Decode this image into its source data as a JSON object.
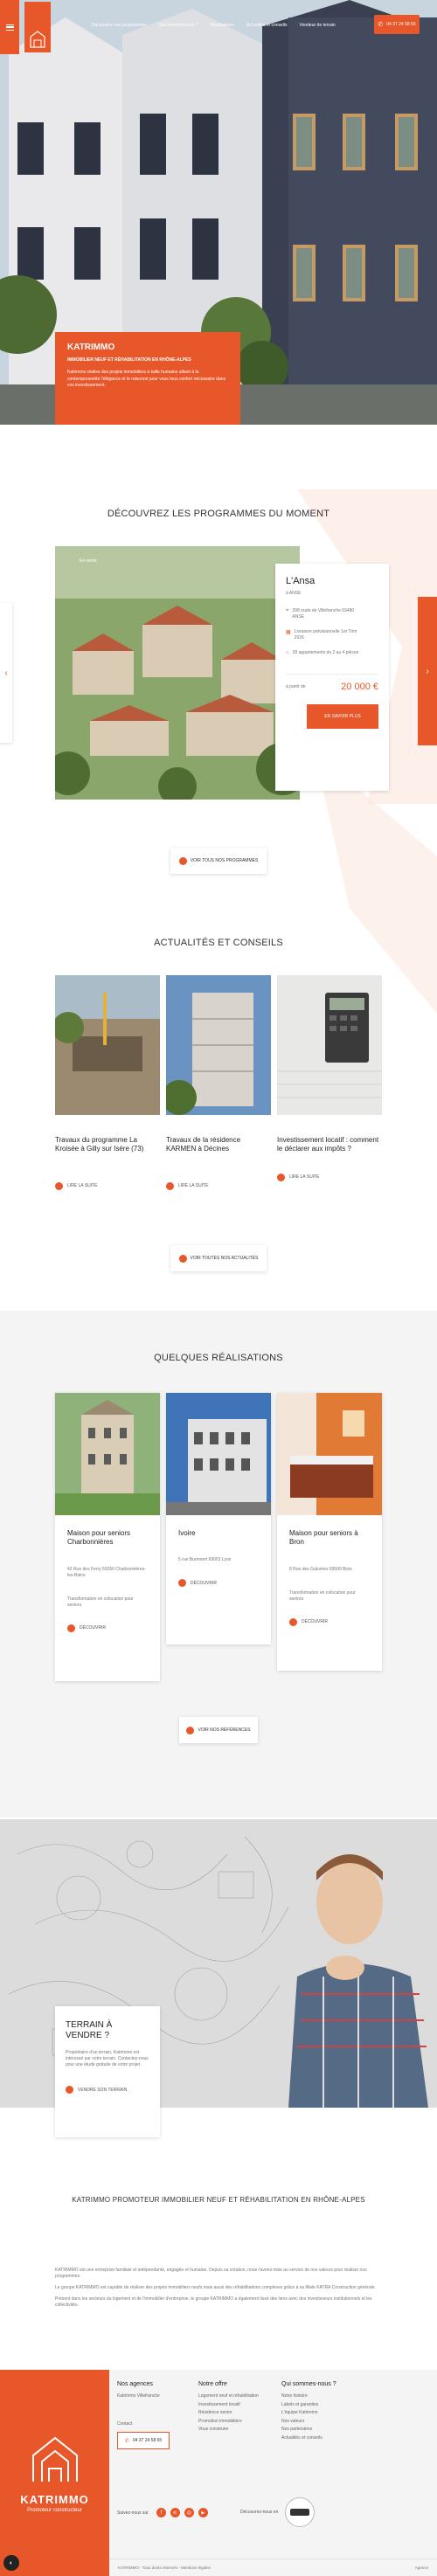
{
  "header": {
    "nav": [
      "Découvrez nos programmes",
      "Qui sommes-nous ?",
      "Réalisations",
      "Actualités et conseils",
      "Vendeur de terrain"
    ],
    "phone": "04 37 24 58 65"
  },
  "hero": {
    "brand": "KATRIMMO",
    "subtitle": "IMMOBILIER NEUF ET RÉHABILITATION EN RHÔNE-ALPES",
    "text": "Katrimmo réalise des projets immobiliers à taille humaine alliant à la contemporanéité l'élégance et le raisonné pour vous tous confort nécessaire dans vos investissement."
  },
  "programs": {
    "title": "DÉCOUVREZ LES PROGRAMMES DU MOMENT",
    "badge": "En vente",
    "name": "L'Ansa",
    "city": "à ANSE",
    "address": "398 route de Villefranche 69480 ANSE",
    "delivery": "Livraison prévisionnelle 1er Trim 2026",
    "lots": "28 appartements du 2 au 4 pièces",
    "price_label": "à partir de",
    "price": "20 000 €",
    "more_button": "EN SAVOIR PLUS",
    "all_button": "VOIR TOUS NOS PROGRAMMES"
  },
  "news": {
    "title": "ACTUALITÉS ET CONSEILS",
    "items": [
      {
        "title": "Travaux du programme La Kroisée à Gilly sur Isère (73)",
        "link": "LIRE LA SUITE"
      },
      {
        "title": "Travaux de la résidence KARMEN à Décines",
        "link": "LIRE LA SUITE"
      },
      {
        "title": "Investissement locatif : comment le déclarer aux impôts ?",
        "link": "LIRE LA SUITE"
      }
    ],
    "all_button": "VOIR TOUTES NOS ACTUALITÉS"
  },
  "realisations": {
    "title": "QUELQUES RÉALISATIONS",
    "items": [
      {
        "title": "Maison pour seniors Charbonnières",
        "address": "42 Rue des Ferry 69260 Charbonnières-les-Bains",
        "desc": "Transformation en colocation pour seniors",
        "link": "DÉCOUVRIR"
      },
      {
        "title": "Ivoire",
        "address": "5 rue Burmond 69003 Lyon",
        "desc": "",
        "link": "DÉCOUVRIR"
      },
      {
        "title": "Maison pour seniors à Bron",
        "address": "8 Rue des Galurnes 69500 Bron",
        "desc": "Transformation en colocation pour seniors",
        "link": "DÉCOUVRIR"
      }
    ],
    "all_button": "VOIR NOS RÉFÉRENCES"
  },
  "terrain": {
    "title": "TERRAIN À VENDRE ?",
    "text": "Propriétaire d'un terrain, Katrimmo est intéressé par votre terrain. Contactez-nous pour une étude gratuite de votre projet.",
    "button": "VENDRE SON TERRAIN"
  },
  "about": {
    "title": "KATRIMMO PROMOTEUR IMMOBILIER NEUF ET RÉHABILITATION EN RHÔNE-ALPES",
    "p1": "KATRIMMO est une entreprise familiale et indépendante, engagée et humaine. Depuis sa création, nous l'avons mise au service de nos valeurs pour réaliser nos programmes.",
    "p2": "Le groupe KATRIMMO est capable de réaliser des projets immobiliers neufs mais aussi des réhabilitations complexes grâce à sa filiale KATRA Construction générale.",
    "p3": "Présent dans les secteurs du logement et de l'immobilier d'entreprise, le groupe KATRIMMO a également tissé des liens avec des investisseurs institutionnels et les collectivités."
  },
  "footer": {
    "logo_text": "KATRIMMO",
    "logo_sub": "Promoteur constructeur",
    "col1_title": "Nos agences",
    "col1_items": [
      "Katrimmo Villefranche"
    ],
    "contact_label": "Contact",
    "phone": "04 37 24 58 65",
    "col2_title": "Notre offre",
    "col2_items": [
      "Logement neuf et réhabilitation",
      "Investissement locatif",
      "Résidence senior",
      "Promotion immobilière",
      "Vous construire"
    ],
    "col3_title": "Qui sommes-nous ?",
    "col3_items": [
      "Notre histoire",
      "Labels et garanties",
      "L'équipe Katrimmo",
      "Nos valeurs",
      "Nos partenaires",
      "Actualités et conseils"
    ],
    "follow": "Suivez-nous sur",
    "discover": "Découvrez-nous en",
    "copyright": "KATRIMMO - Tous droits réservés - Mentions légales",
    "credit": "Agence"
  },
  "colors": {
    "accent": "#e8572a",
    "dark": "#333333",
    "light_bg": "#f4f4f4"
  },
  "icons": [
    "menu-icon",
    "phone-icon",
    "chevron-left-icon",
    "chevron-right-icon",
    "location-icon",
    "calendar-icon",
    "home-icon",
    "arrow-right-icon",
    "facebook-icon",
    "linkedin-icon",
    "instagram-icon",
    "youtube-icon",
    "cookie-icon"
  ]
}
